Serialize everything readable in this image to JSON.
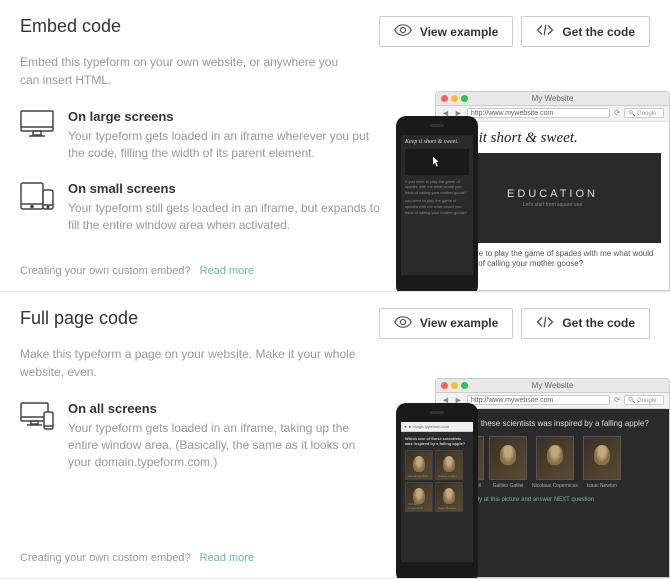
{
  "sections": [
    {
      "title": "Embed code",
      "desc": "Embed this typeform on your own website, or anywhere you can insert HTML.",
      "viewExampleLabel": "View example",
      "getCodeLabel": "Get the code",
      "features": [
        {
          "heading": "On large screens",
          "text": "Your typeform gets loaded in an iframe wherever you put the code, filling the width of its parent element."
        },
        {
          "heading": "On small screens",
          "text": "Your typeform still gets loaded in an iframe, but expands to fill the entire window area when activated."
        }
      ],
      "customEmbedText": "Creating your own custom embed?",
      "readMoreLabel": "Read more"
    },
    {
      "title": "Full page code",
      "desc": "Make this typeform a page on your website. Make it your whole website, even.",
      "viewExampleLabel": "View example",
      "getCodeLabel": "Get the code",
      "features": [
        {
          "heading": "On all screens",
          "text": "Your typeform gets loaded in an iframe, taking up the entire window area. (Basically, the same as it looks on your domain.typeform.com.)"
        }
      ],
      "customEmbedText": "Creating your own custom embed?",
      "readMoreLabel": "Read more"
    }
  ],
  "preview": {
    "browserTitle": "My Website",
    "browserUrl": "http://www.mywebsite.com",
    "searchPlaceholder": "Google",
    "phoneUrl": "magic.typeform.com",
    "embed": {
      "mainHeading": "Keep it short & sweet.",
      "boardTitle": "EDUCATION",
      "boardSub": "Let's start from square one",
      "question": "If you were to play the game of spades with me what would you think of calling your mother goose?",
      "phoneHeading": "Keep it short & sweet.",
      "phoneQ1": "If you were to play the game of spades with me what would you think of calling your mother goose?",
      "phoneQ2": "you were to play the game of spades with me what would you think of calling your mother goose?"
    },
    "fullpage": {
      "question": "ck one of these scientists was inspired by a falling apple?",
      "phoneQuestion": "Which one of these scientists was inspired by a falling apple?",
      "scientists": [
        "Alexander Bell",
        "Galileo Galilei",
        "Nicolaus Copernicus",
        "Isaac Newton"
      ],
      "veryText": "VERY closely at this picture and answer NEXT question"
    }
  }
}
